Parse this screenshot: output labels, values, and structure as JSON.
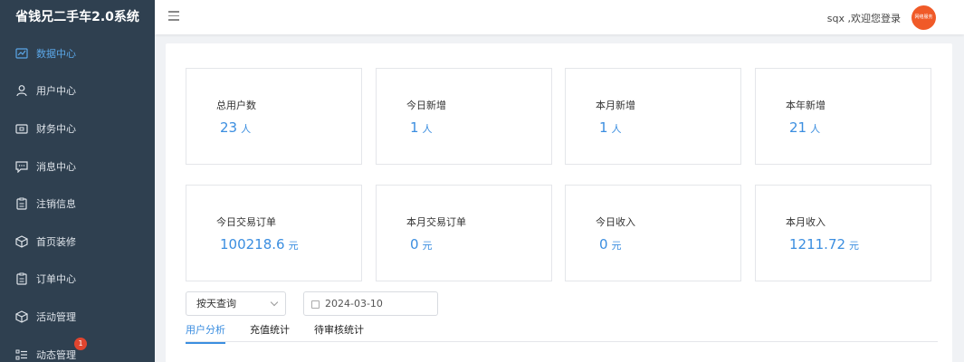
{
  "app": {
    "title": "省钱兄二手车2.0系统"
  },
  "sidebar": {
    "items": [
      {
        "label": "数据中心",
        "icon": "chart-icon",
        "active": true
      },
      {
        "label": "用户中心",
        "icon": "user-icon"
      },
      {
        "label": "财务中心",
        "icon": "wallet-icon"
      },
      {
        "label": "消息中心",
        "icon": "message-icon"
      },
      {
        "label": "注销信息",
        "icon": "clipboard-icon"
      },
      {
        "label": "首页装修",
        "icon": "cube-icon"
      },
      {
        "label": "订单中心",
        "icon": "clipboard-icon"
      },
      {
        "label": "活动管理",
        "icon": "cube-icon"
      },
      {
        "label": "动态管理",
        "icon": "list-icon",
        "badge": "1"
      }
    ]
  },
  "header": {
    "welcome": "sqx ,欢迎您登录",
    "avatar_text": "网络服务"
  },
  "stats": [
    {
      "label": "总用户数",
      "value": "23",
      "unit": "人"
    },
    {
      "label": "今日新增",
      "value": "1",
      "unit": "人"
    },
    {
      "label": "本月新增",
      "value": "1",
      "unit": "人"
    },
    {
      "label": "本年新增",
      "value": "21",
      "unit": "人"
    },
    {
      "label": "今日交易订单",
      "value": "100218.6",
      "unit": "元"
    },
    {
      "label": "本月交易订单",
      "value": "0",
      "unit": "元"
    },
    {
      "label": "今日收入",
      "value": "0",
      "unit": "元"
    },
    {
      "label": "本月收入",
      "value": "1211.72",
      "unit": "元"
    }
  ],
  "filters": {
    "period": "按天查询",
    "date": "2024-03-10"
  },
  "tabs": [
    {
      "label": "用户分析",
      "active": true
    },
    {
      "label": "充值统计"
    },
    {
      "label": "待审核统计"
    }
  ],
  "colors": {
    "sidebar_bg": "#2f4050",
    "accent": "#3b8ee0",
    "badge": "#e0452f",
    "avatar": "#f05a28"
  }
}
